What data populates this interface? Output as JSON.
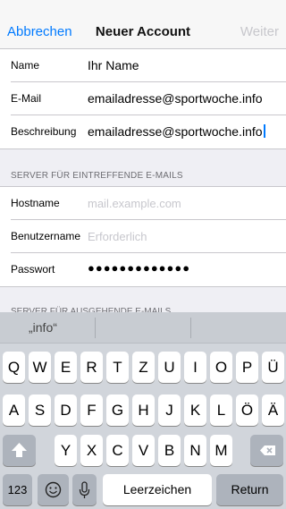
{
  "navbar": {
    "cancel_label": "Abbrechen",
    "title": "Neuer Account",
    "next_label": "Weiter"
  },
  "account": {
    "name_label": "Name",
    "name_value": "Ihr Name",
    "email_label": "E-Mail",
    "email_value": "emailadresse@sportwoche.info",
    "description_label": "Beschreibung",
    "description_value": "emailadresse@sportwoche.info"
  },
  "incoming_server": {
    "section_title": "SERVER FÜR EINTREFFENDE E-MAILS",
    "hostname_label": "Hostname",
    "hostname_placeholder": "mail.example.com",
    "username_label": "Benutzername",
    "username_placeholder": "Erforderlich",
    "password_label": "Passwort",
    "password_value": "●●●●●●●●●●●●●"
  },
  "outgoing_server": {
    "section_title": "SERVER FÜR AUSGEHENDE E-MAILS"
  },
  "keyboard": {
    "suggestion": "„info“",
    "row1": [
      "Q",
      "W",
      "E",
      "R",
      "T",
      "Z",
      "U",
      "I",
      "O",
      "P",
      "Ü"
    ],
    "row2": [
      "A",
      "S",
      "D",
      "F",
      "G",
      "H",
      "J",
      "K",
      "L",
      "Ö",
      "Ä"
    ],
    "row3": [
      "Y",
      "X",
      "C",
      "V",
      "B",
      "N",
      "M"
    ],
    "numbers_label": "123",
    "space_label": "Leerzeichen",
    "return_label": "Return",
    "shift_icon": "shift-arrow-icon",
    "delete_icon": "backspace-icon",
    "emoji_icon": "emoji-icon",
    "mic_icon": "microphone-icon"
  }
}
